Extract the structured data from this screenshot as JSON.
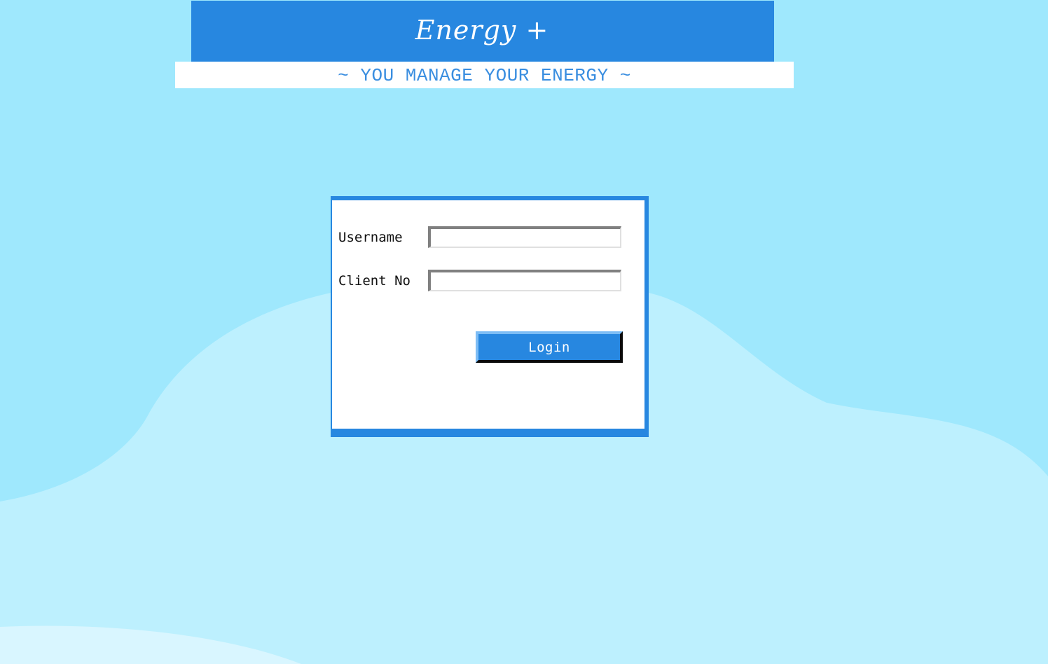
{
  "colors": {
    "background": "#9fe8fd",
    "cloud": "#bdf0fe",
    "cloud_light": "#d9f6ff",
    "accent": "#2787e0",
    "panel": "#ffffff",
    "tagline_text": "#3a8ee0"
  },
  "header": {
    "brand": "Energy +",
    "tagline": "~ YOU MANAGE YOUR ENERGY ~"
  },
  "login_form": {
    "username_label": "Username",
    "username_value": "",
    "client_label": "Client No",
    "client_value": "",
    "login_label": "Login"
  }
}
